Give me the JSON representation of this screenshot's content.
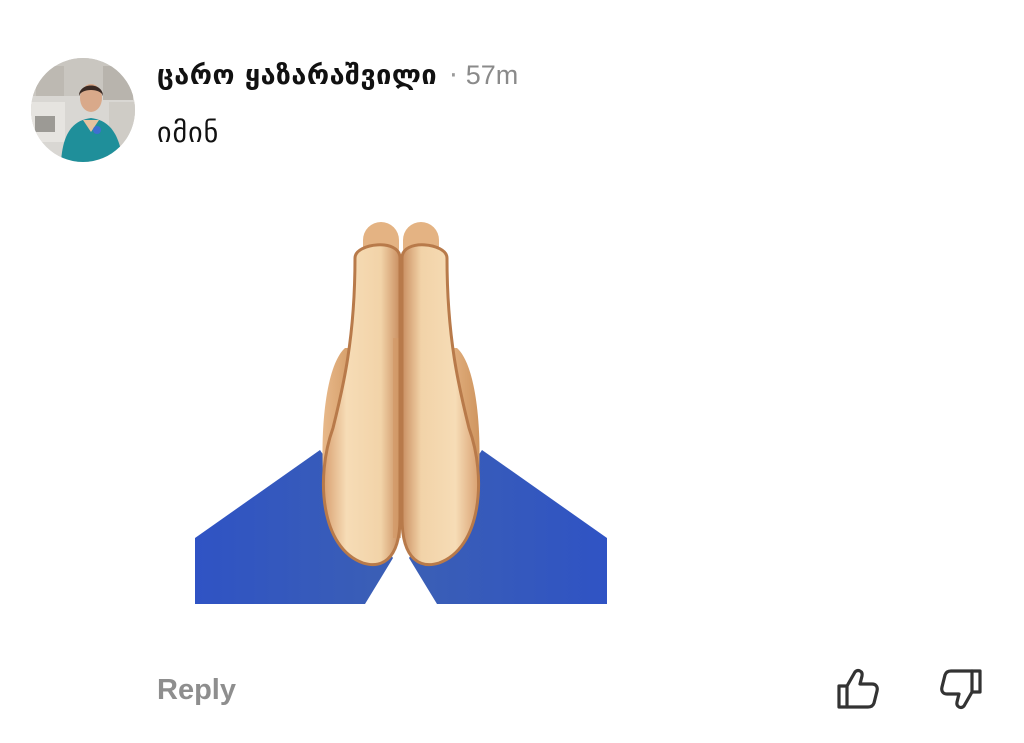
{
  "comment": {
    "author": "ცარო ყაზარაშვილი",
    "separator": "·",
    "time_ago": "57m",
    "text": "იმინ",
    "sticker_icon": "folded-hands-icon",
    "reply_label": "Reply"
  },
  "actions": {
    "like_icon": "thumbs-up-icon",
    "dislike_icon": "thumbs-down-icon"
  },
  "colors": {
    "text": "#111111",
    "muted": "#8e8e8e",
    "sleeve": "#3a5bbf",
    "skin": "#f1d2a8"
  }
}
